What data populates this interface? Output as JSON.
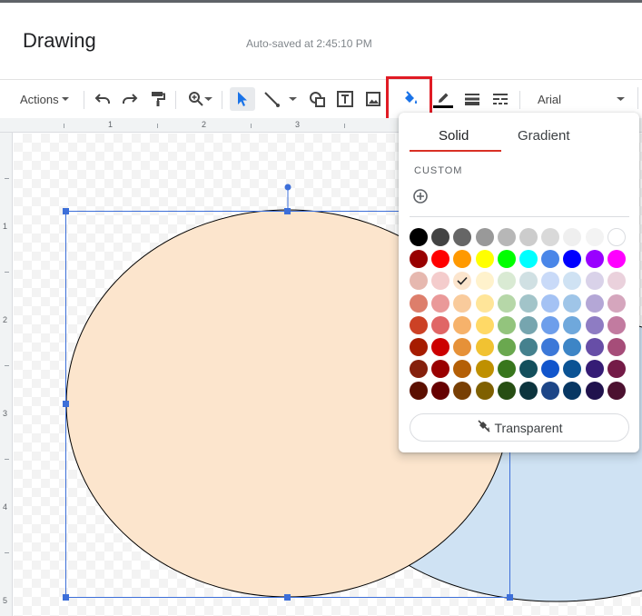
{
  "app": {
    "title": "Drawing",
    "autosave": "Auto-saved at 2:45:10 PM"
  },
  "toolbar": {
    "actions_label": "Actions",
    "font_name": "Arial",
    "highlighted_tool": "fill-color",
    "icons": [
      "undo-icon",
      "redo-icon",
      "paint-format-icon",
      "zoom-icon",
      "select-icon",
      "line-icon",
      "shape-icon",
      "text-box-icon",
      "image-icon",
      "fill-color-icon",
      "border-color-icon",
      "border-weight-icon",
      "border-dash-icon"
    ],
    "accent_highlight": "#e01b24"
  },
  "ruler": {
    "top_numbers": [
      "1",
      "2",
      "3"
    ],
    "left_numbers": [
      "1",
      "2",
      "3",
      "4",
      "5"
    ]
  },
  "canvas": {
    "shape_left_fill": "#fce5cd",
    "shape_right_fill": "#cfe2f3",
    "selection_color": "#3d6fd9"
  },
  "palette": {
    "tabs": [
      "Solid",
      "Gradient"
    ],
    "active_tab": "Solid",
    "custom_label": "CUSTOM",
    "transparent_label": "Transparent",
    "selected_color": "#fce5cd",
    "colors": [
      [
        "#000000",
        "#434343",
        "#666666",
        "#999999",
        "#b7b7b7",
        "#cccccc",
        "#d9d9d9",
        "#efefef",
        "#f3f3f3",
        "#ffffff"
      ],
      [
        "#980000",
        "#ff0000",
        "#ff9900",
        "#ffff00",
        "#00ff00",
        "#00ffff",
        "#4a86e8",
        "#0000ff",
        "#9900ff",
        "#ff00ff"
      ],
      [
        "#e6b8af",
        "#f4cccc",
        "#fce5cd",
        "#fff2cc",
        "#d9ead3",
        "#d0e0e3",
        "#c9daf8",
        "#cfe2f3",
        "#d9d2e9",
        "#ead1dc"
      ],
      [
        "#dd7e6b",
        "#ea9999",
        "#f9cb9c",
        "#ffe599",
        "#b6d7a8",
        "#a2c4c9",
        "#a4c2f4",
        "#9fc5e8",
        "#b4a7d6",
        "#d5a6bd"
      ],
      [
        "#cc4125",
        "#e06666",
        "#f6b26b",
        "#ffd966",
        "#93c47d",
        "#76a5af",
        "#6d9eeb",
        "#6fa8dc",
        "#8e7cc3",
        "#c27ba0"
      ],
      [
        "#a61c00",
        "#cc0000",
        "#e69138",
        "#f1c232",
        "#6aa84f",
        "#45818e",
        "#3c78d8",
        "#3d85c6",
        "#674ea7",
        "#a64d79"
      ],
      [
        "#85200c",
        "#990000",
        "#b45f06",
        "#bf9000",
        "#38761d",
        "#134f5c",
        "#1155cc",
        "#0b5394",
        "#351c75",
        "#741b47"
      ],
      [
        "#5b0f00",
        "#660000",
        "#783f04",
        "#7f6000",
        "#274e13",
        "#0c343d",
        "#1c4587",
        "#073763",
        "#20124d",
        "#4c1130"
      ]
    ]
  }
}
